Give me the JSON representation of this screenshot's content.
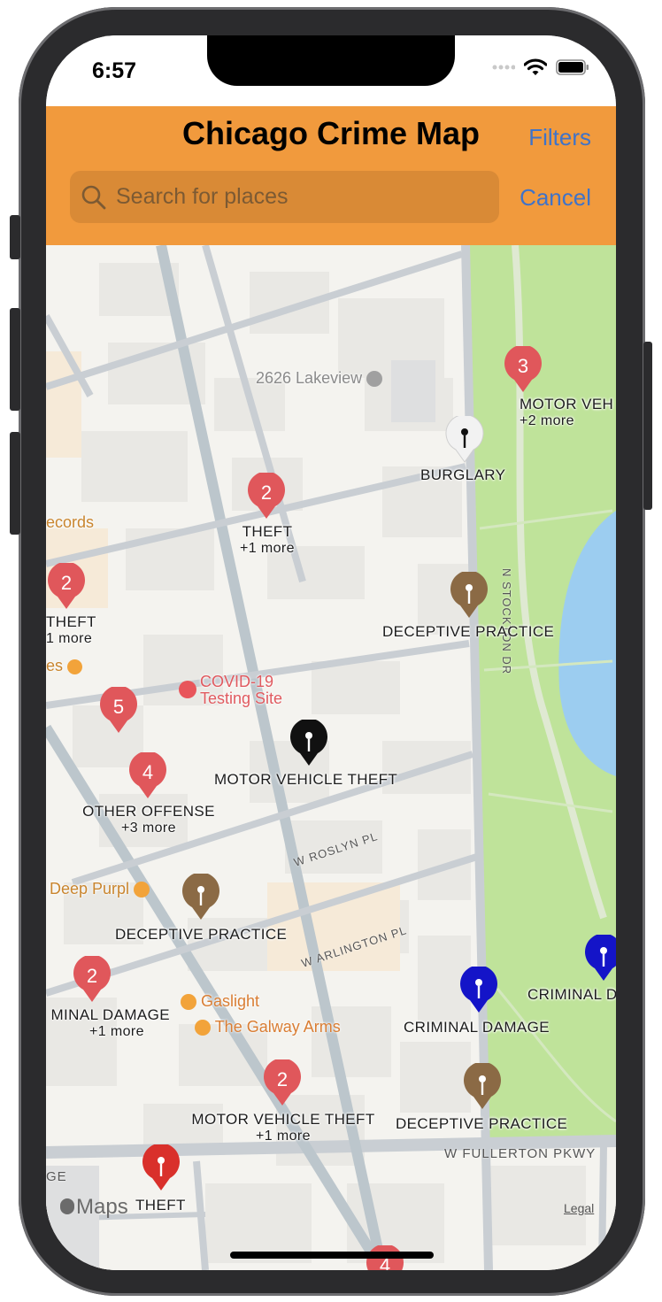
{
  "status_bar": {
    "time": "6:57"
  },
  "header": {
    "title": "Chicago Crime Map",
    "filters_label": "Filters",
    "cancel_label": "Cancel",
    "search_placeholder": "Search for places"
  },
  "colors": {
    "header_bg": "#f19a3d",
    "cluster_red": "#e0575b",
    "theft_red": "#d9302b",
    "deceptive_brown": "#8b6a45",
    "criminal_damage_blue": "#1414c8",
    "motor_vehicle_black": "#111111",
    "burglary_white": "#f2f2f2",
    "park_green": "#bfe39a",
    "water_blue": "#9ccdf0"
  },
  "map": {
    "landmarks": {
      "lakeview": "2626 Lakeview",
      "records": "ecords",
      "es": "es",
      "covid": "COVID-19\nTesting Site",
      "deep_purple": "Deep Purpl",
      "gaslight": "Gaslight",
      "galway": "The Galway Arms"
    },
    "streets": {
      "stockton": "N STOCKTON DR",
      "roslyn": "W ROSLYN PL",
      "arlington": "W ARLINGTON PL",
      "fullerton": "W FULLERTON PKWY",
      "ge": "GE"
    },
    "markers": {
      "m1": {
        "count": "3",
        "label": "MOTOR VEH",
        "more": "+2 more"
      },
      "m2": {
        "label": "BURGLARY"
      },
      "m3": {
        "count": "2",
        "label": "THEFT",
        "more": "+1 more"
      },
      "m4": {
        "count": "2",
        "label": "THEFT",
        "more": "1 more"
      },
      "m5": {
        "label": "DECEPTIVE PRACTICE"
      },
      "m6": {
        "count": "5"
      },
      "m7": {
        "label": "MOTOR VEHICLE THEFT"
      },
      "m8": {
        "count": "4",
        "label": "OTHER OFFENSE",
        "more": "+3 more"
      },
      "m9": {
        "label": "DECEPTIVE PRACTICE"
      },
      "m10": {
        "count": "2",
        "label": "MINAL DAMAGE",
        "more": "+1 more"
      },
      "m11": {
        "label": "CRIMINAL DAMAGE"
      },
      "m12": {
        "label": "CRIMINAL D"
      },
      "m13": {
        "count": "2",
        "label": "MOTOR VEHICLE THEFT",
        "more": "+1 more"
      },
      "m14": {
        "label": "DECEPTIVE PRACTICE"
      },
      "m15": {
        "label": "THEFT"
      },
      "m16": {
        "count": "4"
      }
    },
    "attribution": {
      "maps": "Maps",
      "legal": "Legal"
    }
  }
}
